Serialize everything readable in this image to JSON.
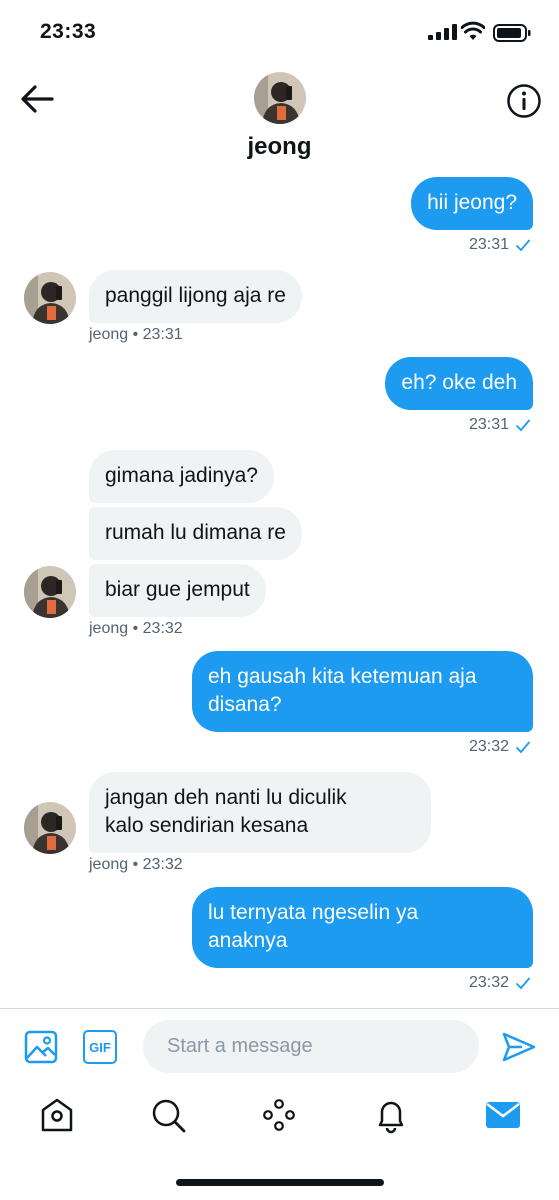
{
  "status_bar": {
    "time": "23:33"
  },
  "header": {
    "name": "jeong"
  },
  "messages": [
    {
      "text": "hii jeong?",
      "meta": "23:31"
    },
    {
      "text": "panggil lijong aja re",
      "meta": "jeong • 23:31"
    },
    {
      "text": "eh? oke deh",
      "meta": "23:31"
    },
    {
      "text": "gimana jadinya?"
    },
    {
      "text": "rumah lu dimana re"
    },
    {
      "text": "biar gue jemput",
      "meta": "jeong • 23:32"
    },
    {
      "text": "eh gausah kita ketemuan aja\ndisana?",
      "meta": "23:32"
    },
    {
      "text": "jangan deh nanti lu diculik\nkalo sendirian kesana",
      "meta": "jeong • 23:32"
    },
    {
      "text": "lu ternyata ngeselin ya\nanaknya",
      "meta": "23:32"
    }
  ],
  "composer": {
    "placeholder": "Start a message",
    "gif_label": "GIF"
  },
  "colors": {
    "accent": "#1d9bf0",
    "incoming_bubble": "#eff3f4",
    "meta_text": "#536471"
  },
  "icons": {
    "composer": [
      "image-icon",
      "gif-icon",
      "send-icon"
    ],
    "tabs": [
      "home-icon",
      "search-icon",
      "spaces-icon",
      "notifications-icon",
      "messages-icon"
    ]
  }
}
